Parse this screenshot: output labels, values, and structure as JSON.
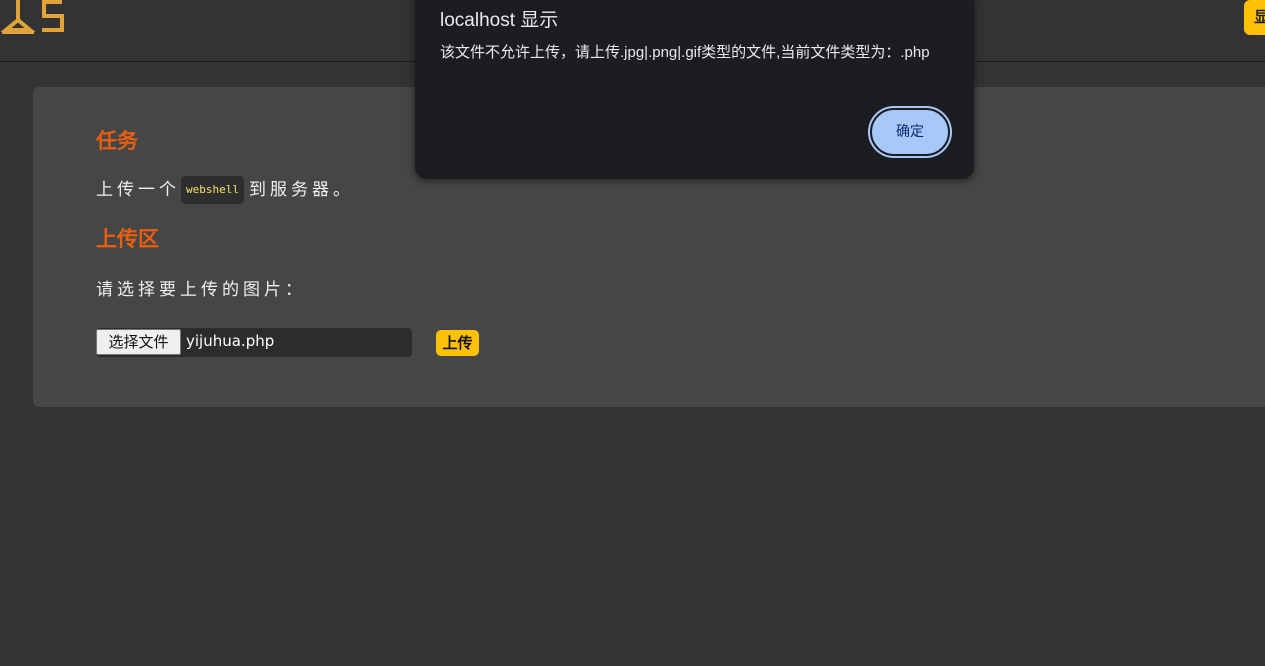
{
  "header": {
    "logo_icon": "ts-logo-icon",
    "logo_color": "#e0a33a",
    "right_button_label": "显示"
  },
  "task": {
    "title": "任务",
    "text_before": "上传一个",
    "code": "webshell",
    "text_after": "到服务器。"
  },
  "upload": {
    "title": "上传区",
    "prompt": "请选择要上传的图片：",
    "choose_label": "选择文件",
    "file_name": "yijuhua.php",
    "submit_label": "上传"
  },
  "dialog": {
    "title": "localhost 显示",
    "message": "该文件不允许上传，请上传.jpg|.png|.gif类型的文件,当前文件类型为：.php",
    "ok_label": "确定"
  },
  "colors": {
    "accent_orange": "#e8600f",
    "button_yellow": "#ffc107",
    "dialog_button": "#a8c7fa"
  }
}
